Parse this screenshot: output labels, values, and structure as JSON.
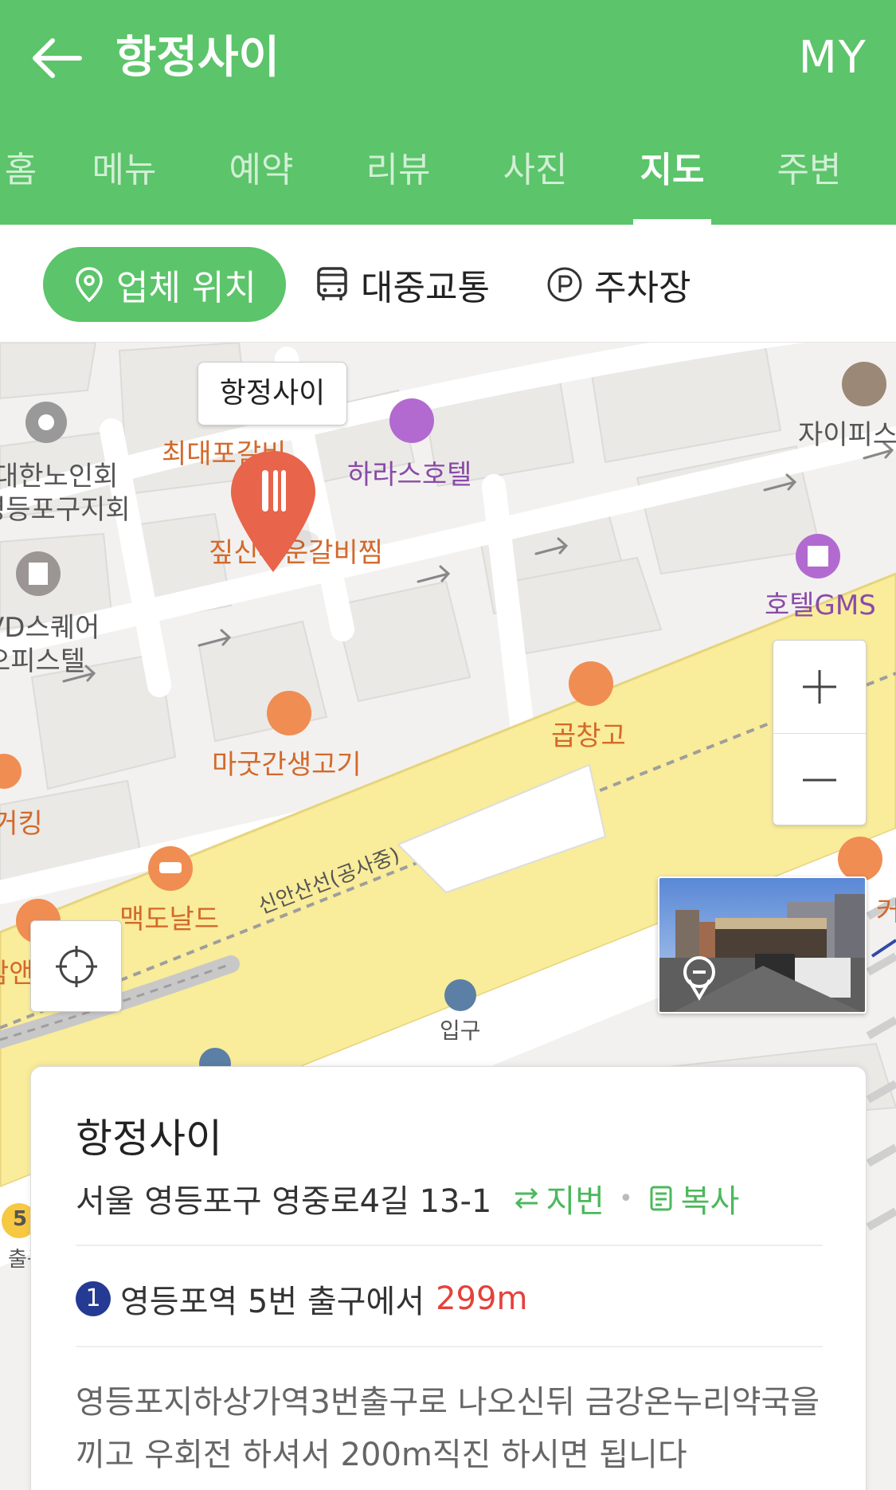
{
  "header": {
    "title": "항정사이",
    "my_label": "MY",
    "back_icon": "arrow-left-icon"
  },
  "tabs": [
    {
      "label": "홈",
      "active": false
    },
    {
      "label": "메뉴",
      "active": false
    },
    {
      "label": "예약",
      "active": false
    },
    {
      "label": "리뷰",
      "active": false
    },
    {
      "label": "사진",
      "active": false
    },
    {
      "label": "지도",
      "active": true
    },
    {
      "label": "주변",
      "active": false
    }
  ],
  "chips": [
    {
      "label": "업체 위치",
      "icon": "location-pin-icon",
      "active": true
    },
    {
      "label": "대중교통",
      "icon": "bus-icon",
      "active": false
    },
    {
      "label": "주차장",
      "icon": "parking-icon",
      "active": false
    }
  ],
  "map": {
    "pin_label": "항정사이",
    "labels": {
      "choidae": "최대포갈비",
      "hotel_haras": "하라스호텔",
      "jjim": "짚신우운갈비찜",
      "hotel_gms": "호텔GMS",
      "xi": "자이피스",
      "senior1": "대한노인회",
      "senior2": "영등포구지회",
      "vd1": "VD스퀘어",
      "vd2": "오피스텔",
      "magut": "마굿간생고기",
      "gopchang": "곱창고",
      "burgerking": "버거킹",
      "mcdonalds": "맥도날드",
      "subway_line": "신안산선(공사중)",
      "entrance": "입구",
      "exit5_num": "5",
      "exit5_label": "출구",
      "cafe_partial": "탐앤",
      "right_partial": "커스"
    },
    "zoom_in": "+",
    "zoom_out": "−"
  },
  "card": {
    "title": "항정사이",
    "address": "서울 영등포구 영중로4길 13-1",
    "jibun_label": "지번",
    "copy_label": "복사",
    "subway_line": "1",
    "subway_text": "영등포역 5번 출구에서",
    "distance": "299m",
    "directions": "영등포지하상가역3번출구로 나오신뒤 금강온누리약국을 끼고 우회전 하셔서 200m직진 하시면 됩니다"
  },
  "colors": {
    "brand_green": "#5cc46a",
    "pin_red": "#e8644a",
    "distance_red": "#e5413b",
    "subway_blue": "#243a93",
    "road_yellow": "#f9ec9a"
  }
}
